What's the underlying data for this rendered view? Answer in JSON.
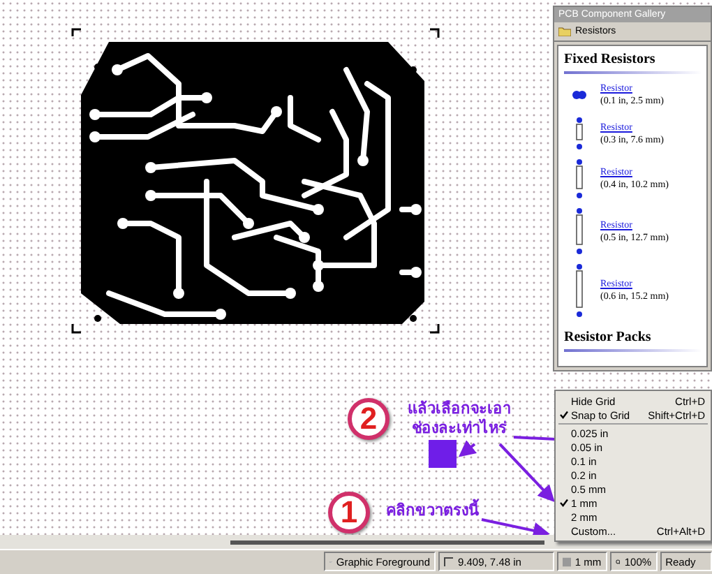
{
  "gallery": {
    "title": "PCB Component Gallery",
    "folder": "Resistors",
    "sections": [
      {
        "heading": "Fixed Resistors",
        "items": [
          {
            "name": "Resistor",
            "size": "(0.1 in, 2.5 mm)"
          },
          {
            "name": "Resistor",
            "size": "(0.3 in, 7.6 mm)"
          },
          {
            "name": "Resistor",
            "size": "(0.4 in, 10.2 mm)"
          },
          {
            "name": "Resistor",
            "size": "(0.5 in, 12.7 mm)"
          },
          {
            "name": "Resistor",
            "size": "(0.6 in, 15.2 mm)"
          }
        ]
      },
      {
        "heading": "Resistor Packs"
      }
    ]
  },
  "annotations": [
    {
      "number": "2",
      "text": "แล้วเลือกจะเอา ช่องละเท่าไหร่"
    },
    {
      "number": "1",
      "text": "คลิกขวาตรงนี้"
    }
  ],
  "context_menu": {
    "items": [
      {
        "kind": "item",
        "label": "Hide Grid",
        "shortcut": "Ctrl+D",
        "checked": false
      },
      {
        "kind": "item",
        "label": "Snap to Grid",
        "shortcut": "Shift+Ctrl+D",
        "checked": true
      },
      {
        "kind": "separator"
      },
      {
        "kind": "item",
        "label": "0.025 in",
        "checked": false
      },
      {
        "kind": "item",
        "label": "0.05 in",
        "checked": false
      },
      {
        "kind": "item",
        "label": "0.1 in",
        "checked": false
      },
      {
        "kind": "item",
        "label": "0.2 in",
        "checked": false
      },
      {
        "kind": "item",
        "label": "0.5 mm",
        "checked": false
      },
      {
        "kind": "item",
        "label": "1 mm",
        "checked": true
      },
      {
        "kind": "item",
        "label": "2 mm",
        "checked": false
      },
      {
        "kind": "item",
        "label": "Custom...",
        "shortcut": "Ctrl+Alt+D",
        "checked": false
      }
    ]
  },
  "status_bar": {
    "layer": "Graphic Foreground",
    "coordinates": "9.409, 7.48 in",
    "grid": "1 mm",
    "zoom": "100%",
    "status": "Ready"
  }
}
